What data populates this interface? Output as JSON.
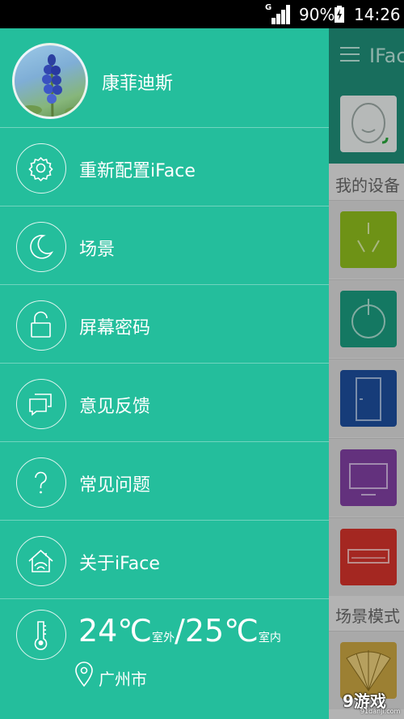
{
  "status_bar": {
    "network": "G",
    "battery": "90%",
    "time": "14:26"
  },
  "background_app": {
    "title": "IFac",
    "section_devices": "我的设备",
    "section_scenes": "场景模式",
    "device_colors": [
      "#8dbb1d",
      "#1a9a7e",
      "#1d4e9b",
      "#7f3fa0",
      "#d2322b"
    ]
  },
  "drawer": {
    "user_name": "康菲迪斯",
    "menu": [
      {
        "label": "重新配置iFace",
        "icon": "gear-icon"
      },
      {
        "label": "场景",
        "icon": "moon-icon"
      },
      {
        "label": "屏幕密码",
        "icon": "lock-icon"
      },
      {
        "label": "意见反馈",
        "icon": "chat-icon"
      },
      {
        "label": "常见问题",
        "icon": "question-icon"
      },
      {
        "label": "关于iFace",
        "icon": "home-icon"
      }
    ],
    "weather": {
      "outdoor_temp": "24℃",
      "outdoor_label": "室外",
      "separator": "/",
      "indoor_temp": "25℃",
      "indoor_label": "室内",
      "city": "广州市",
      "icon": "thermometer-icon"
    },
    "colors": {
      "drawer_bg": "#24be9c",
      "app_bar": "#1f8d78"
    }
  },
  "watermark": {
    "brand": "9游戏",
    "domain": "91danji.com"
  }
}
